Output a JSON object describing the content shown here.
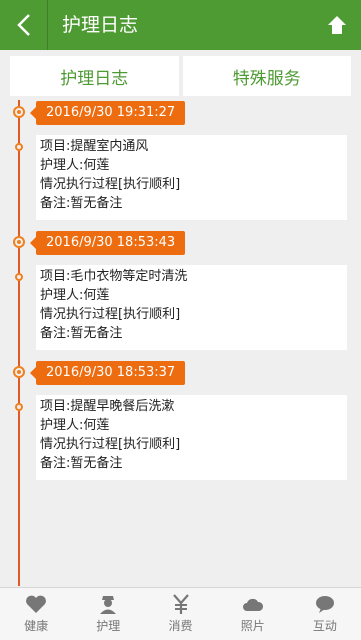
{
  "header": {
    "title": "护理日志"
  },
  "tabs": [
    {
      "label": "护理日志"
    },
    {
      "label": "特殊服务"
    }
  ],
  "entries": [
    {
      "date": "2016/9/30 19:31:27",
      "item": "项目:提醒室内通风",
      "caregiver": "护理人:何莲",
      "status": "情况执行过程[执行顺利]",
      "note": "备注:暂无备注"
    },
    {
      "date": "2016/9/30 18:53:43",
      "item": "项目:毛巾衣物等定时清洗",
      "caregiver": "护理人:何莲",
      "status": "情况执行过程[执行顺利]",
      "note": "备注:暂无备注"
    },
    {
      "date": "2016/9/30 18:53:37",
      "item": "项目:提醒早晚餐后洗漱",
      "caregiver": "护理人:何莲",
      "status": "情况执行过程[执行顺利]",
      "note": "备注:暂无备注"
    }
  ],
  "nav": [
    {
      "label": "健康",
      "icon": "heart-icon"
    },
    {
      "label": "护理",
      "icon": "nurse-icon"
    },
    {
      "label": "消费",
      "icon": "yen-icon"
    },
    {
      "label": "照片",
      "icon": "cloud-icon"
    },
    {
      "label": "互动",
      "icon": "chat-bubble-icon"
    }
  ],
  "colors": {
    "header": "#4e9a33",
    "accent": "#ed6c10",
    "timeline": "#e05a28"
  }
}
